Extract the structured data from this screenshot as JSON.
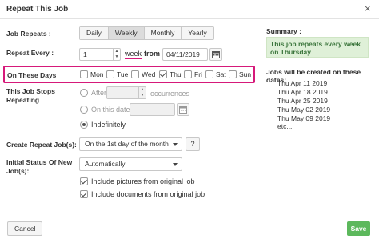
{
  "dialog": {
    "title": "Repeat This Job",
    "close_glyph": "×"
  },
  "job_repeats": {
    "label": "Job Repeats :",
    "options": [
      {
        "label": "Daily"
      },
      {
        "label": "Weekly"
      },
      {
        "label": "Monthly"
      },
      {
        "label": "Yearly"
      }
    ],
    "selected": "Weekly"
  },
  "repeat_every": {
    "label": "Repeat Every :",
    "value": "1",
    "unit": "week",
    "from_label": "from",
    "from_date": "04/11/2019"
  },
  "on_these_days": {
    "label": "On These Days",
    "days": [
      {
        "label": "Mon",
        "checked": false
      },
      {
        "label": "Tue",
        "checked": false
      },
      {
        "label": "Wed",
        "checked": false
      },
      {
        "label": "Thu",
        "checked": true
      },
      {
        "label": "Fri",
        "checked": false
      },
      {
        "label": "Sat",
        "checked": false
      },
      {
        "label": "Sun",
        "checked": false
      }
    ],
    "highlight_color": "#d6197a"
  },
  "stops_repeating": {
    "label_line1": "This Job Stops",
    "label_line2": "Repeating",
    "after_label": "After",
    "occurrences_label": "occurrences",
    "on_date_label": "On this date",
    "indefinitely_label": "Indefinitely",
    "selected": "Indefinitely"
  },
  "create_repeat": {
    "label": "Create Repeat Job(s):",
    "value": "On the 1st day of the month",
    "help_label": "?"
  },
  "initial_status": {
    "label_line1": "Initial Status Of New",
    "label_line2": "Job(s):",
    "value": "Automatically",
    "include_pictures": "Include pictures from original job",
    "include_documents": "Include documents from original job"
  },
  "summary": {
    "title": "Summary :",
    "text": "This job repeats every week on Thursday",
    "jobs_title": "Jobs will be created on these dates:",
    "dates": [
      "Thu Apr 11 2019",
      "Thu Apr 18 2019",
      "Thu Apr 25 2019",
      "Thu May 02 2019",
      "Thu May 09 2019",
      "etc..."
    ]
  },
  "footer": {
    "cancel_label": "Cancel",
    "save_label": "Save"
  },
  "colors": {
    "accent_green": "#5cb85c",
    "summary_bg": "#dff0d8",
    "summary_text": "#3c763d"
  }
}
